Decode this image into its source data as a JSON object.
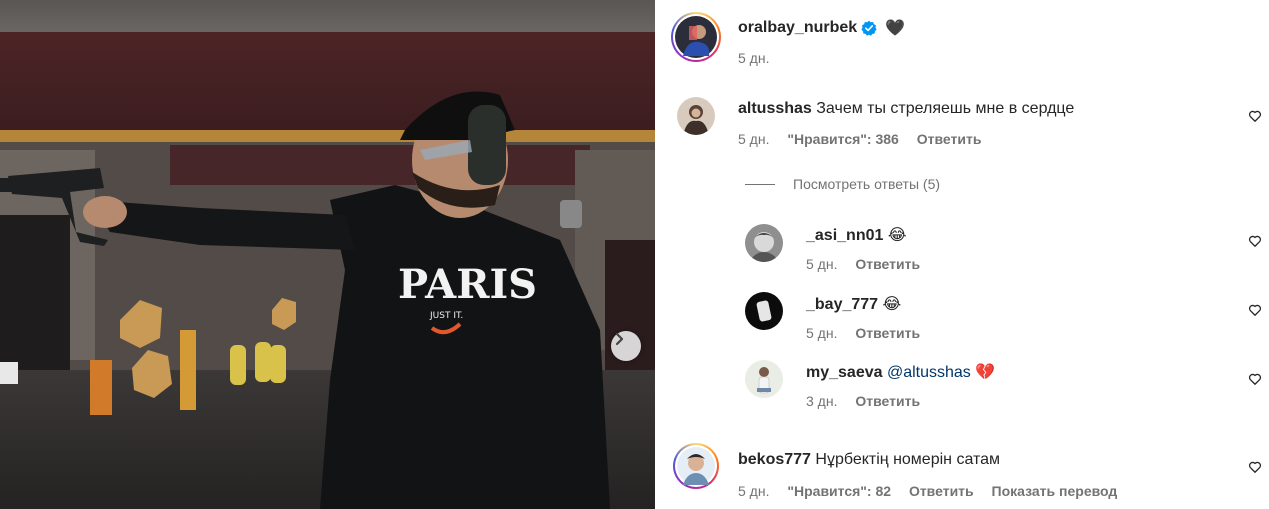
{
  "post": {
    "author": "oralbay_nurbek",
    "verified_icon": "verified-badge-icon",
    "heart_emoji": "🖤",
    "time": "5 дн.",
    "photo_text": "PARIS",
    "photo_subtext": "JUST IT."
  },
  "labels": {
    "reply": "Ответить",
    "translate": "Показать перевод"
  },
  "comments": [
    {
      "username": "altusshas",
      "text": "Зачем ты стреляешь мне в сердце",
      "time": "5 дн.",
      "likes": "\"Нравится\": 386",
      "view_replies": "Посмотреть ответы (5)",
      "replies": [
        {
          "username": "_asi_nn01",
          "text": "😂",
          "time": "5 дн."
        },
        {
          "username": "_bay_777",
          "text": "😂",
          "time": "5 дн."
        },
        {
          "username": "my_saeva",
          "mention": "@altusshas",
          "text": "💔",
          "time": "3 дн."
        }
      ]
    },
    {
      "username": "bekos777",
      "text": "Нұрбектің номерін сатам",
      "time": "5 дн.",
      "likes": "\"Нравится\": 82"
    }
  ],
  "colors": {
    "text": "#262626",
    "secondary": "#737373",
    "mention": "#00376b",
    "verified": "#0095f6"
  }
}
